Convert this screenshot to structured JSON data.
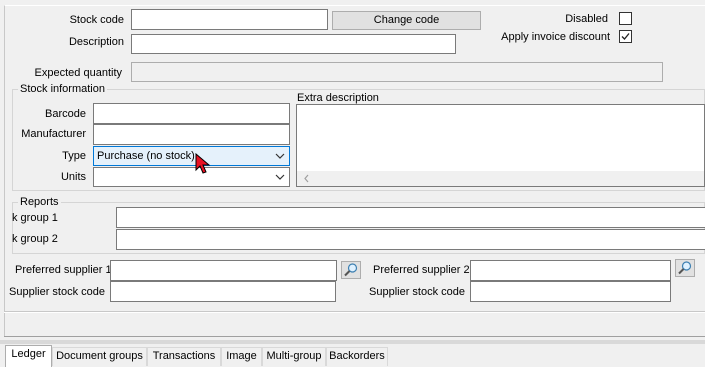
{
  "fields": {
    "stock_code_label": "Stock code",
    "stock_code_value": "",
    "change_code_label": "Change code",
    "description_label": "Description",
    "description_value": "",
    "disabled_label": "Disabled",
    "disabled_checked": false,
    "apply_invoice_discount_label": "Apply invoice discount",
    "apply_invoice_discount_checked": true,
    "expected_quantity_label": "Expected quantity",
    "expected_quantity_value": ""
  },
  "stock_information": {
    "title": "Stock information",
    "barcode_label": "Barcode",
    "barcode_value": "",
    "manufacturer_label": "Manufacturer",
    "manufacturer_value": "",
    "type_label": "Type",
    "type_value": "Purchase (no stock)",
    "units_label": "Units",
    "units_value": "",
    "extra_description_label": "Extra description",
    "extra_description_value": ""
  },
  "reports": {
    "title": "Reports",
    "group1_label": "k group 1",
    "group1_value": "",
    "group2_label": "k group 2",
    "group2_value": ""
  },
  "suppliers": {
    "preferred1_label": "Preferred supplier 1",
    "preferred1_value": "",
    "stock_code1_label": "Supplier stock code",
    "stock_code1_value": "",
    "preferred2_label": "Preferred supplier 2",
    "preferred2_value": "",
    "stock_code2_label": "Supplier stock code",
    "stock_code2_value": ""
  },
  "tabs": [
    {
      "label": "Ledger",
      "active": true
    },
    {
      "label": "Document groups",
      "active": false
    },
    {
      "label": "Transactions",
      "active": false
    },
    {
      "label": "Image",
      "active": false
    },
    {
      "label": "Multi-group",
      "active": false
    },
    {
      "label": "Backorders",
      "active": false
    }
  ],
  "icons": {
    "dropdown": "chevron-down-icon",
    "lookup": "magnifier-icon",
    "cursor": "mouse-pointer-icon",
    "scroll_left": "scroll-left-arrow-icon"
  },
  "colors": {
    "window_bg": "#f0f0f0",
    "focus_border": "#0078d7",
    "focus_bg": "#e5f1fb",
    "cursor": "#e81123"
  }
}
